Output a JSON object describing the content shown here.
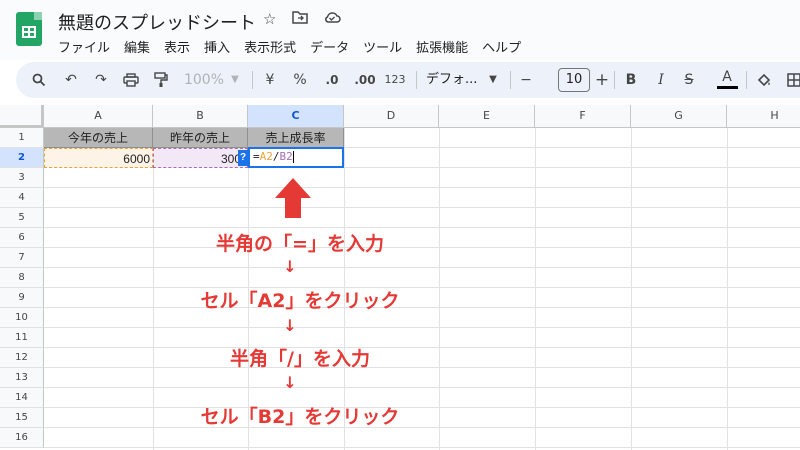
{
  "app": {
    "doc_title": "無題のスプレッドシート",
    "title_icons": [
      "star-icon",
      "folder-move-icon",
      "cloud-saved-icon"
    ]
  },
  "menu": [
    "ファイル",
    "編集",
    "表示",
    "挿入",
    "表示形式",
    "データ",
    "ツール",
    "拡張機能",
    "ヘルプ"
  ],
  "toolbar": {
    "zoom": "100%",
    "currency": "¥",
    "percent": "%",
    "dec_decrease": ".0",
    "dec_increase": ".00",
    "number_format": "123",
    "font": "デフォ...",
    "font_size": "10",
    "bold": "B",
    "italic": "I",
    "strike": "S",
    "text_color": "A",
    "minus": "−",
    "plus": "+",
    "text_color_hex": "#000000"
  },
  "sheet": {
    "columns": [
      "A",
      "B",
      "C",
      "D",
      "E",
      "F",
      "G",
      "H"
    ],
    "rows": [
      "1",
      "2",
      "3",
      "4",
      "5",
      "6",
      "7",
      "8",
      "9",
      "10",
      "11",
      "12",
      "13",
      "14",
      "15",
      "16"
    ],
    "selected_column": "C",
    "selected_row": "2",
    "header_row": [
      "今年の売上",
      "昨年の売上",
      "売上成長率"
    ],
    "a2": "6000",
    "b2": "300",
    "formula": {
      "eq": "=",
      "ref1": "A2",
      "slash": "/",
      "ref2": "B2"
    },
    "help_badge": "?"
  },
  "annotation": {
    "steps": [
      "半角の「=」を入力",
      "セル「A2」をクリック",
      "半角「/」を入力",
      "セル「B2」をクリック"
    ],
    "arrow": "↓",
    "color": "#e53935"
  },
  "colors": {
    "accent": "#1a73e8",
    "a2_ref": "#e8a33d",
    "b2_ref": "#a66fb5",
    "header_fill": "#b7b7b7"
  }
}
